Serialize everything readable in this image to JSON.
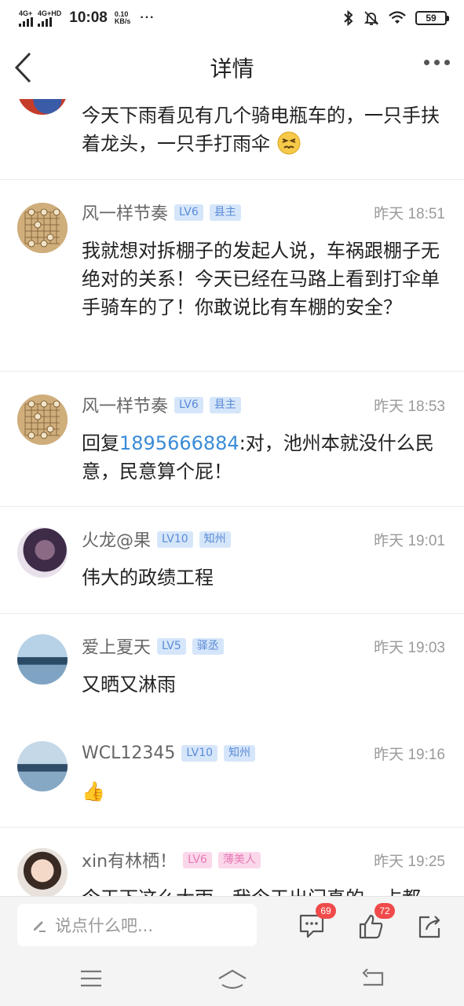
{
  "status_bar": {
    "signal1": "4G+",
    "signal2": "4G+HD",
    "time": "10:08",
    "speed_value": "0.10",
    "speed_unit": "KB/s",
    "more": "···",
    "battery": "59"
  },
  "header": {
    "title": "详情"
  },
  "comments": [
    {
      "body": "今天下雨看见有几个骑电瓶车的，一只手扶着龙头，一只手打雨伞",
      "emoji": "persevering-face-emoji"
    },
    {
      "user": "风一样节奏",
      "level": "LV6",
      "tag": "县主",
      "time": "昨天 18:51",
      "body": "我就想对拆棚子的发起人说，车祸跟棚子无绝对的关系！今天已经在马路上看到打伞单手骑车的了！你敢说比有车棚的安全？"
    },
    {
      "user": "风一样节奏",
      "level": "LV6",
      "tag": "县主",
      "time": "昨天 18:53",
      "reply_prefix": "回复",
      "reply_to": "1895666884",
      "body": ":对，池州本就没什么民意，民意算个屁！"
    },
    {
      "user": "火龙@果",
      "level": "LV10",
      "tag": "知州",
      "time": "昨天 19:01",
      "body": "伟大的政绩工程"
    },
    {
      "user": "爱上夏天",
      "level": "LV5",
      "tag": "驿丞",
      "time": "昨天 19:03",
      "body": "又晒又淋雨"
    },
    {
      "user": "WCL12345",
      "level": "LV10",
      "tag": "知州",
      "time": "昨天 19:16",
      "body": "👍"
    },
    {
      "user": "xin有林栖！",
      "level": "LV6",
      "tag": "薄美人",
      "time": "昨天 19:25",
      "body": "今天下这么大雨，我今天出门真的，占都"
    }
  ],
  "action_bar": {
    "input_placeholder": "说点什么吧...",
    "comment_count": "69",
    "like_count": "72"
  },
  "colors": {
    "link": "#3a8bd6",
    "badge_blue": "#5a8bd6",
    "badge_pink": "#e87bb6",
    "count_badge": "#f04a4a"
  }
}
